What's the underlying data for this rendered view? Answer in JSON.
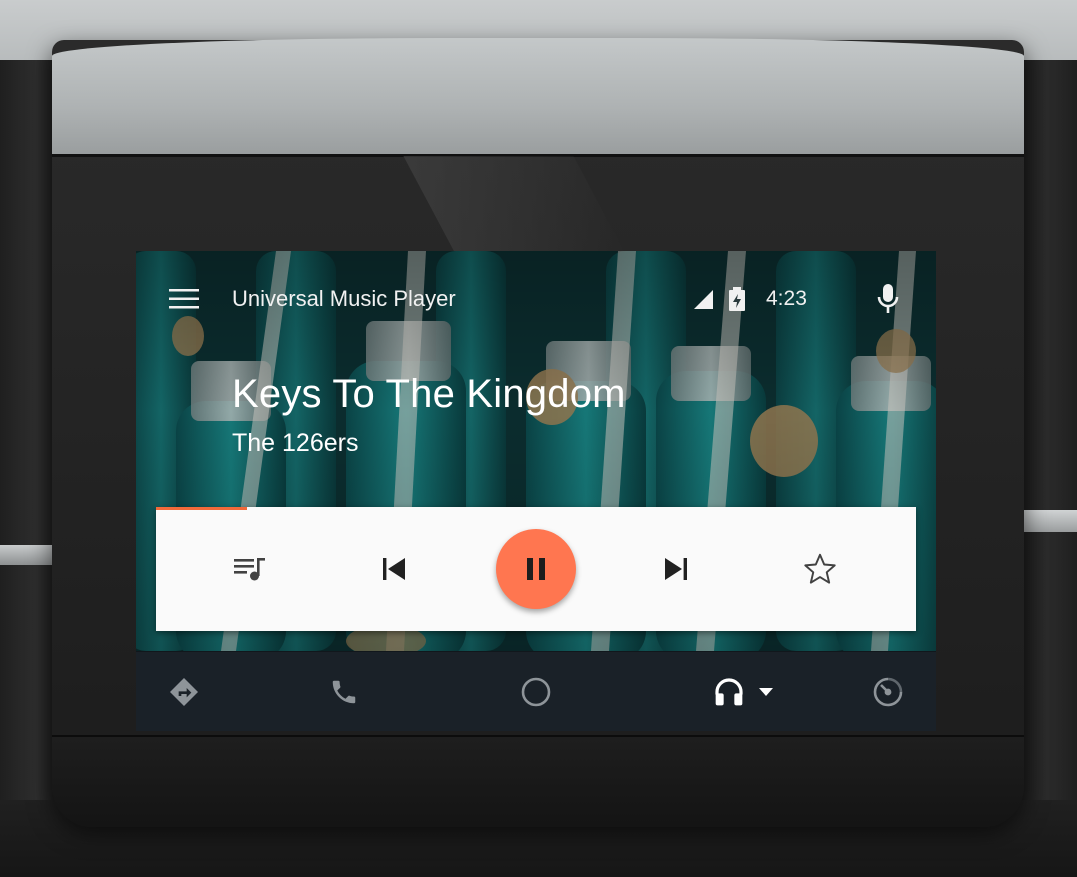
{
  "app": {
    "title": "Universal Music Player"
  },
  "status_bar": {
    "time": "4:23",
    "signal_icon": "cell-signal-icon",
    "battery_icon": "battery-charging-icon"
  },
  "now_playing": {
    "title": "Keys To The Kingdom",
    "artist": "The 126ers",
    "progress_fraction": 0.12,
    "state": "playing"
  },
  "controls": [
    {
      "name": "queue-button",
      "icon": "queue-music-icon"
    },
    {
      "name": "previous-button",
      "icon": "skip-previous-icon"
    },
    {
      "name": "pause-button",
      "icon": "pause-icon"
    },
    {
      "name": "next-button",
      "icon": "skip-next-icon"
    },
    {
      "name": "favorite-button",
      "icon": "star-outline-icon"
    }
  ],
  "nav_bar": [
    {
      "name": "nav-navigation",
      "icon": "directions-icon",
      "active": false
    },
    {
      "name": "nav-phone",
      "icon": "phone-icon",
      "active": false
    },
    {
      "name": "nav-home",
      "icon": "home-circle-icon",
      "active": false
    },
    {
      "name": "nav-audio",
      "icon": "headphones-icon",
      "active": true
    },
    {
      "name": "nav-exit",
      "icon": "exit-icon",
      "active": false
    }
  ],
  "colors": {
    "accent": "#ff7650",
    "progress": "#f26a3a",
    "card_background": "#fafafa",
    "nav_background": "#1a2128",
    "nav_icon_inactive": "#8e9499",
    "nav_icon_active": "#ffffff",
    "control_icon": "#424242"
  }
}
